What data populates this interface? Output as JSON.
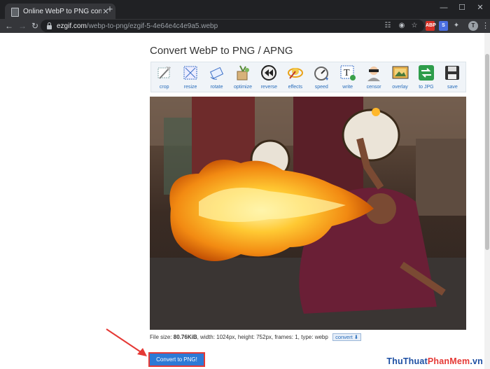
{
  "browser": {
    "tab_title": "Online WebP to PNG converter",
    "tab_close": "✕",
    "new_tab": "+",
    "url_host": "ezgif.com",
    "url_path": "/webp-to-png/ezgif-5-4e64e4c4e9a5.webp",
    "profile_initial": "T",
    "window_controls": [
      "—",
      "☐",
      "✕"
    ]
  },
  "page": {
    "title": "Convert WebP to PNG / APNG",
    "tools": [
      {
        "label": "crop",
        "icon": "crop-icon"
      },
      {
        "label": "resize",
        "icon": "resize-icon"
      },
      {
        "label": "rotate",
        "icon": "rotate-icon"
      },
      {
        "label": "optimize",
        "icon": "optimize-icon"
      },
      {
        "label": "reverse",
        "icon": "reverse-icon"
      },
      {
        "label": "effects",
        "icon": "effects-icon"
      },
      {
        "label": "speed",
        "icon": "speed-icon"
      },
      {
        "label": "write",
        "icon": "write-icon"
      },
      {
        "label": "censor",
        "icon": "censor-icon"
      },
      {
        "label": "overlay",
        "icon": "overlay-icon"
      },
      {
        "label": "to JPG",
        "icon": "to-jpg-icon"
      },
      {
        "label": "save",
        "icon": "save-icon"
      }
    ],
    "file_info": {
      "size_label": "File size: ",
      "size_value": "80.76KiB",
      "rest": ", width: 1024px, height: 752px, frames: 1, type: webp"
    },
    "convert_link": "convert",
    "convert_button": "Convert to PNG!"
  },
  "watermark": {
    "part1": "Thu",
    "part2": "Thuat",
    "part3": "PhanMem",
    "part4": ".vn"
  },
  "colors": {
    "chrome_dark": "#202124",
    "accent_button": "#2d7ad6",
    "highlight_red": "#e53935"
  }
}
